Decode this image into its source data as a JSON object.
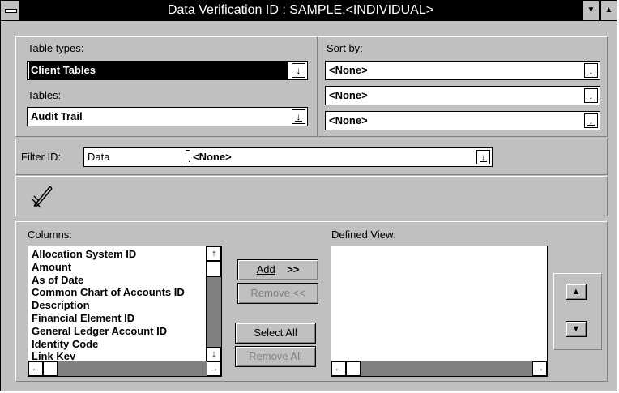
{
  "window": {
    "title": "Data Verification ID : SAMPLE.<INDIVIDUAL>",
    "minimize_glyph": "▼",
    "maximize_glyph": "▲"
  },
  "table_types": {
    "label": "Table types:",
    "value": "Client Tables"
  },
  "tables": {
    "label": "Tables:",
    "value": "Audit Trail"
  },
  "sort_by": {
    "label": "Sort by:",
    "values": [
      "<None>",
      "<None>",
      "<None>"
    ]
  },
  "filter": {
    "label": "Filter ID:",
    "type_value": "Data",
    "value": "<None>"
  },
  "columns": {
    "label": "Columns:",
    "items": [
      "Allocation System ID",
      "Amount",
      "As of Date",
      "Common Chart of Accounts ID",
      "Description",
      "Financial Element ID",
      "General Ledger Account ID",
      "Identity Code",
      "Link Key"
    ]
  },
  "defined_view": {
    "label": "Defined View:",
    "items": []
  },
  "buttons": {
    "add": "Add",
    "add_arrows": ">>",
    "remove": "Remove <<",
    "select_all": "Select All",
    "remove_all": "Remove All"
  },
  "icons": {
    "dropdown": "dropdown-arrow-icon",
    "filter_tool": "pencil-edit-icon",
    "move_up": "up-triangle-icon",
    "move_down": "down-triangle-icon"
  }
}
